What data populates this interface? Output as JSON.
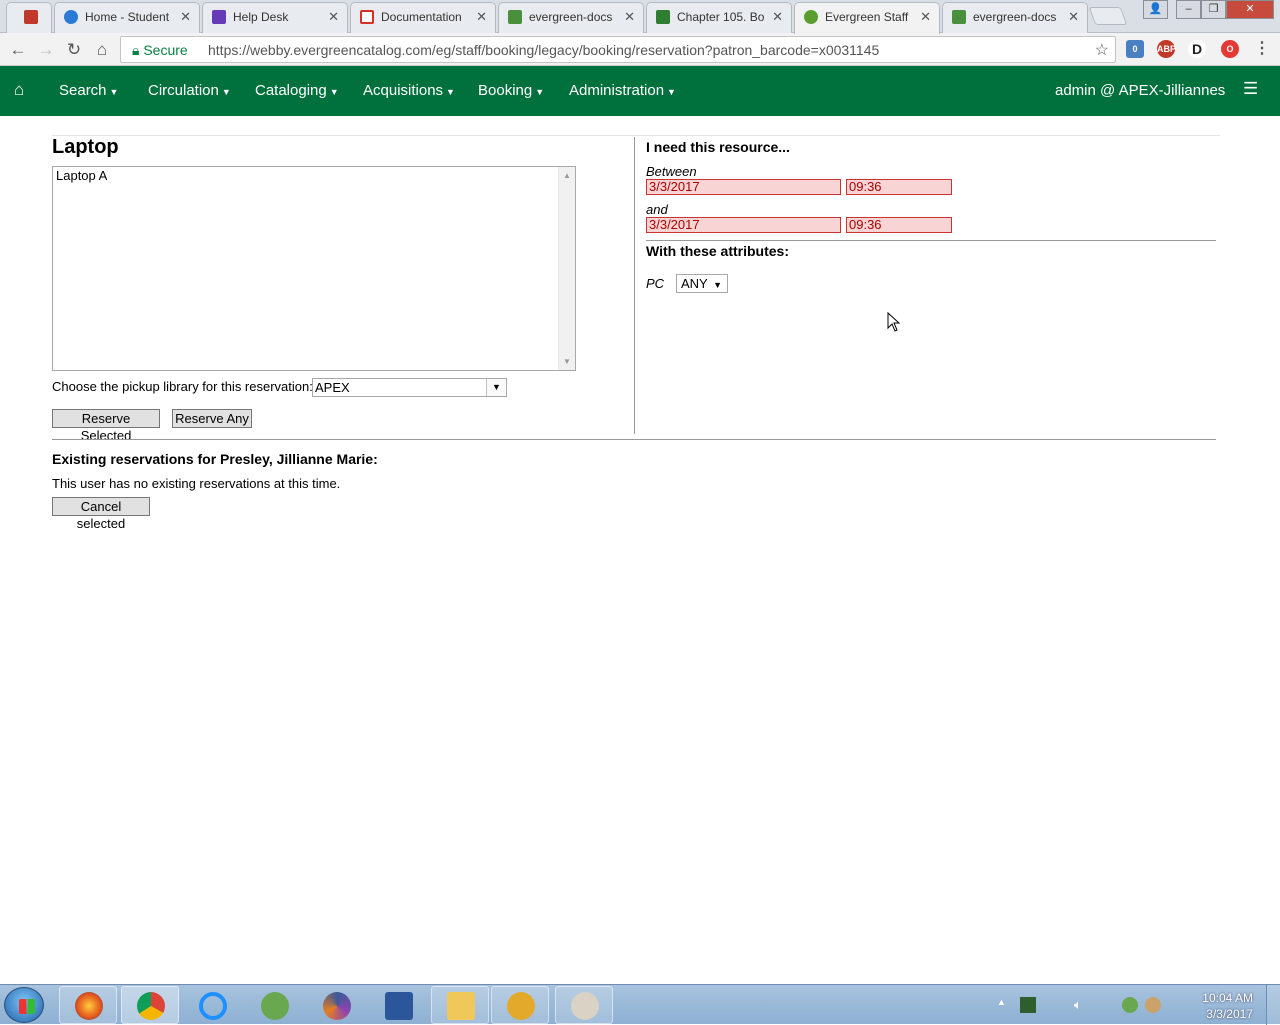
{
  "browser": {
    "tabs": [
      {
        "title": "",
        "icon": "gift-icon",
        "color": "#c0392b"
      },
      {
        "title": "Home - Student",
        "icon": "cloud-icon",
        "color": "#2b7bd6"
      },
      {
        "title": "Help Desk",
        "icon": "form-icon",
        "color": "#673ab7"
      },
      {
        "title": "Documentation",
        "icon": "gmail-icon",
        "color": "#d93025"
      },
      {
        "title": "evergreen-docs",
        "icon": "docs-icon",
        "color": "#4a8f3c"
      },
      {
        "title": "Chapter 105. Bo",
        "icon": "book-icon",
        "color": "#2e7d32"
      },
      {
        "title": "Evergreen Staff",
        "icon": "evergreen-icon",
        "color": "#5a9e2f"
      },
      {
        "title": "evergreen-docs",
        "icon": "docs-icon",
        "color": "#4a8f3c"
      }
    ],
    "secure_label": "Secure",
    "url": "https://webby.evergreencatalog.com/eg/staff/booking/legacy/booking/reservation?patron_barcode=x0031145",
    "extension_badge": "0"
  },
  "navbar": {
    "search": "Search",
    "circulation": "Circulation",
    "cataloging": "Cataloging",
    "acquisitions": "Acquisitions",
    "booking": "Booking",
    "administration": "Administration",
    "user": "admin @ APEX-Jilliannes"
  },
  "resource": {
    "title": "Laptop",
    "items": [
      "Laptop A"
    ],
    "pickup_label": "Choose the pickup library for this reservation:",
    "pickup_value": "APEX",
    "reserve_selected": "Reserve Selected",
    "reserve_any": "Reserve Any"
  },
  "need": {
    "title": "I need this resource...",
    "between_label": "Between",
    "start_date": "3/3/2017",
    "start_time": "09:36",
    "and_label": "and",
    "end_date": "3/3/2017",
    "end_time": "09:36",
    "attributes_title": "With these attributes:",
    "pc_label": "PC",
    "pc_value": "ANY"
  },
  "existing": {
    "title": "Existing reservations for Presley, Jillianne Marie:",
    "empty_message": "This user has no existing reservations at this time.",
    "cancel_selected": "Cancel selected"
  },
  "taskbar": {
    "apps": [
      "firefox-icon",
      "chrome-icon",
      "ie-icon",
      "frog-icon",
      "spiral-icon",
      "word-icon",
      "explorer-icon",
      "evergreen-icon",
      "paint-icon"
    ],
    "time": "10:04 AM",
    "date": "3/3/2017"
  }
}
